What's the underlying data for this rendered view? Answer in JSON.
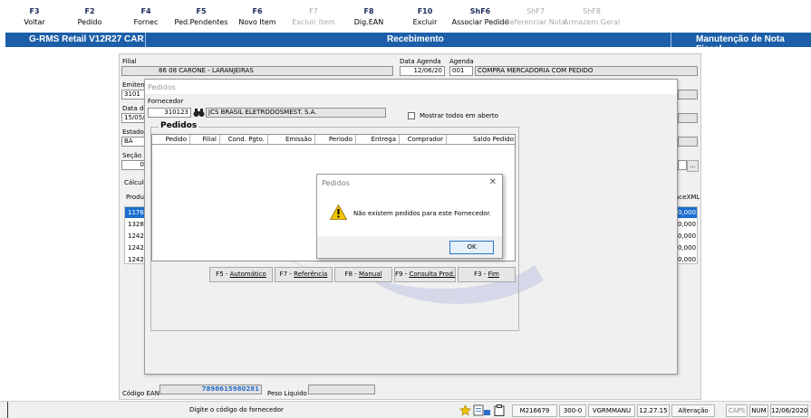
{
  "fkeys": [
    {
      "key": "F3",
      "label": "Voltar",
      "enabled": true
    },
    {
      "key": "F2",
      "label": "Pedido",
      "enabled": true
    },
    {
      "key": "F4",
      "label": "Fornec",
      "enabled": true
    },
    {
      "key": "F5",
      "label": "Ped.Pendentes",
      "enabled": true
    },
    {
      "key": "F6",
      "label": "Novo Item",
      "enabled": true
    },
    {
      "key": "F7",
      "label": "Excluir Item",
      "enabled": false
    },
    {
      "key": "F8",
      "label": "Dig.EAN",
      "enabled": true
    },
    {
      "key": "F10",
      "label": "Excluir",
      "enabled": true
    },
    {
      "key": "ShF6",
      "label": "Associar Pedido",
      "enabled": true
    },
    {
      "key": "ShF7",
      "label": "Referenciar Nota",
      "enabled": false
    },
    {
      "key": "ShF8",
      "label": "Armazem Geral",
      "enabled": false
    }
  ],
  "titlebar": {
    "app": "G-RMS Retail V12R27 CAR",
    "module": "Recebimento",
    "screen": "Manutenção de Nota Fiscal"
  },
  "form": {
    "filial_label": "Filial",
    "filial_value": "86  08 CARONE - LARANJEIRAS",
    "data_agenda_label": "Data Agenda",
    "data_agenda_value": "12/06/20",
    "agenda_label": "Agenda",
    "agenda_code": "001",
    "agenda_desc": "COMPRA MERCADORIA COM PEDIDO",
    "emitente_label": "Emitente",
    "emitente_value": "3101",
    "data_de_label": "Data de",
    "data_de_value": "15/05/",
    "estado_label": "Estado",
    "estado_value": "BA",
    "secao_label": "Seção",
    "secao_value": "0",
    "calculo_label": "Cálculo",
    "produto_header": "Produt",
    "produto_rows": [
      "11765",
      "13284",
      "12426",
      "12425",
      "12425"
    ],
    "xml_header": "aceXML",
    "xml_rows": [
      "0,000",
      "0,000",
      "0,000",
      "0,000",
      "0,000"
    ],
    "ellipsis": "...",
    "codigo_ean_label": "Código EAN",
    "codigo_ean_value": "7898615980281",
    "peso_liquido_label": "Peso Liquido"
  },
  "pedidos_dialog": {
    "title": "Pedidos",
    "fornecedor_label": "Fornecedor",
    "fornecedor_code": "310123",
    "fornecedor_name": "JCS BRASIL ELETRODOSMEST. S.A.",
    "mostrar_label": "Mostrar todos em aberto",
    "group_title": "Pedidos",
    "columns": [
      "Pedido",
      "Filial",
      "Cond. Pgto.",
      "Emissão",
      "Periodo",
      "Entrega",
      "Comprador",
      "Saldo Pedido"
    ],
    "buttons": {
      "f5_key": "F5 - ",
      "f5_label": "Automático",
      "f7_key": "F7 - ",
      "f7_label": "Referência",
      "f8_key": "F8 - ",
      "f8_label": "Manual",
      "f9_key": "F9 - ",
      "f9_label": "Consulta Prod.",
      "f3_key": "F3 - ",
      "f3_label": "Fim"
    }
  },
  "message_box": {
    "title": "Pedidos",
    "text": "Não existem pedidos para este Fornecedor.",
    "ok_label": "OK"
  },
  "statusbar": {
    "hint": "Digite o código do fornecedor",
    "user_code": "M216679",
    "branch": "300-0",
    "system": "VGRMMANU",
    "version": "12.27.15",
    "mode": "Alteração",
    "caps": "CAPS",
    "num": "NUM",
    "date": "12/06/2020"
  },
  "colors": {
    "title_bar": "#1c5fa8",
    "selection": "#1c6fd0",
    "ean_text": "#2a6fc9"
  }
}
